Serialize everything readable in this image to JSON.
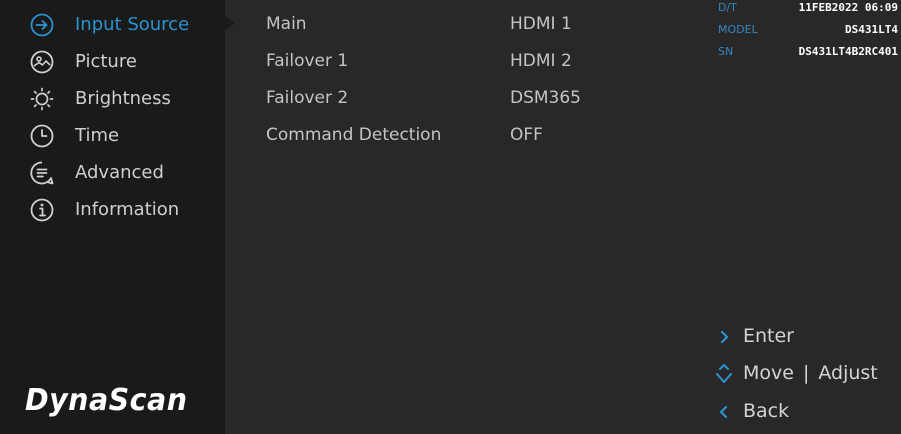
{
  "sidebar": {
    "items": [
      {
        "label": "Input Source",
        "icon": "arrow-right-circle-icon",
        "active": true
      },
      {
        "label": "Picture",
        "icon": "picture-icon",
        "active": false
      },
      {
        "label": "Brightness",
        "icon": "brightness-icon",
        "active": false
      },
      {
        "label": "Time",
        "icon": "clock-icon",
        "active": false
      },
      {
        "label": "Advanced",
        "icon": "advanced-icon",
        "active": false
      },
      {
        "label": "Information",
        "icon": "info-icon",
        "active": false
      }
    ],
    "logo": "DynaScan"
  },
  "settings": [
    {
      "name": "Main",
      "value": "HDMI 1"
    },
    {
      "name": "Failover 1",
      "value": "HDMI 2"
    },
    {
      "name": "Failover 2",
      "value": "DSM365"
    },
    {
      "name": "Command Detection",
      "value": "OFF"
    }
  ],
  "device_info": {
    "dt_label": "D/T",
    "dt_value": "11FEB2022 06:09",
    "model_label": "MODEL",
    "model_value": "DS431LT4",
    "sn_label": "SN",
    "sn_value": "DS431LT4B2RC401"
  },
  "hints": {
    "enter": "Enter",
    "move": "Move",
    "separator": "|",
    "adjust": "Adjust",
    "back": "Back"
  },
  "colors": {
    "accent": "#2a93d0",
    "sidebar_bg": "#1a1a1a",
    "panel_bg": "#282828"
  }
}
